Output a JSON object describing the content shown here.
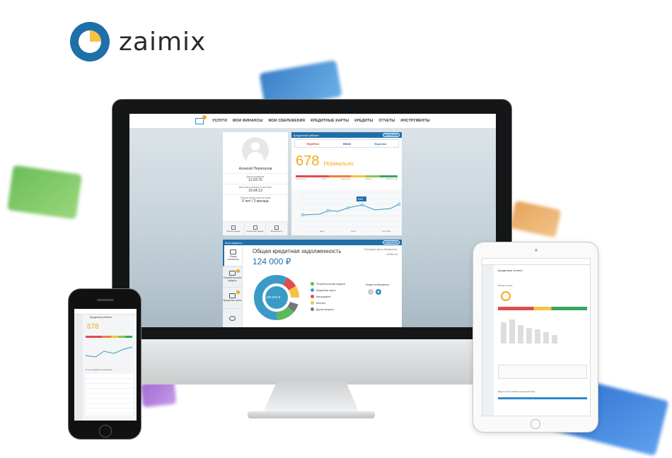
{
  "brand": {
    "name": "zaimix",
    "colors": {
      "blue": "#1f6fa8",
      "accent": "#2e8bc9",
      "orange": "#f5a623"
    }
  },
  "nav": {
    "items": [
      "УСЛУГИ",
      "МОИ ФИНАНСЫ",
      "МОИ СБЕРЕЖЕНИЯ",
      "КРЕДИТНЫЕ КАРТЫ",
      "КРЕДИТЫ",
      "ОТЧЕТЫ",
      "ИНСТРУМЕНТЫ"
    ],
    "mail_badge": "1"
  },
  "profile": {
    "name": "Алексей Перепалов",
    "birth_label": "Дата рождения",
    "birth_value": "12.03.75",
    "reg_label": "Дата регистрации в системе",
    "reg_value": "15.04.13",
    "history_label": "Общая кредитная история",
    "history_value": "5 лет / 3 месяца",
    "actions": [
      "Личные данные",
      "Контактные данные",
      "Безопасность"
    ]
  },
  "rating": {
    "title": "Кредитный рейтинг",
    "more_label": "Подробнее",
    "bureaus": [
      "EQUIFAX",
      "НБКИ",
      "Experian"
    ],
    "score": "678",
    "score_text": "Нормально",
    "scale_ticks": [
      "300",
      "600",
      "700",
      "750",
      "800",
      "850"
    ],
    "scale_labels": [
      "Очень плохо",
      "Плохо",
      "Нормально",
      "Хорошо",
      "Великолепно"
    ],
    "chart_value": "648",
    "months": [
      "март",
      "июль",
      "сентябрь"
    ]
  },
  "credits": {
    "title": "Мои кредиты",
    "more_label": "Подробнее",
    "tabs": [
      "Общая статистика",
      "Потребительские кредиты",
      "Кредитные карты"
    ],
    "debt_title": "Общая кредитная задолженность",
    "debt_amount": "124 000 ₽",
    "updated_label": "Последнее дата обновления:",
    "updated_date": "13.04.13",
    "donut_center": "230 000 ₽",
    "legend": [
      {
        "label": "Потребительские кредиты",
        "color": "#5cb85c"
      },
      {
        "label": "Кредитные карты",
        "color": "#3a9bc7"
      },
      {
        "label": "Автокредиты",
        "color": "#e24b4b"
      },
      {
        "label": "Ипотека",
        "color": "#f5c243"
      },
      {
        "label": "Другие кредиты",
        "color": "#777777"
      }
    ],
    "view_mode_label": "Режим отображения"
  },
  "phone": {
    "title": "Кредитный рейтинг",
    "score": "678",
    "list_title": "Отчет кредитного рейтинга"
  },
  "tablet": {
    "title": "Кредитные отчеты",
    "subtitle": "Общая оценка",
    "bottom_title": "Видео использования кредитной карт"
  }
}
